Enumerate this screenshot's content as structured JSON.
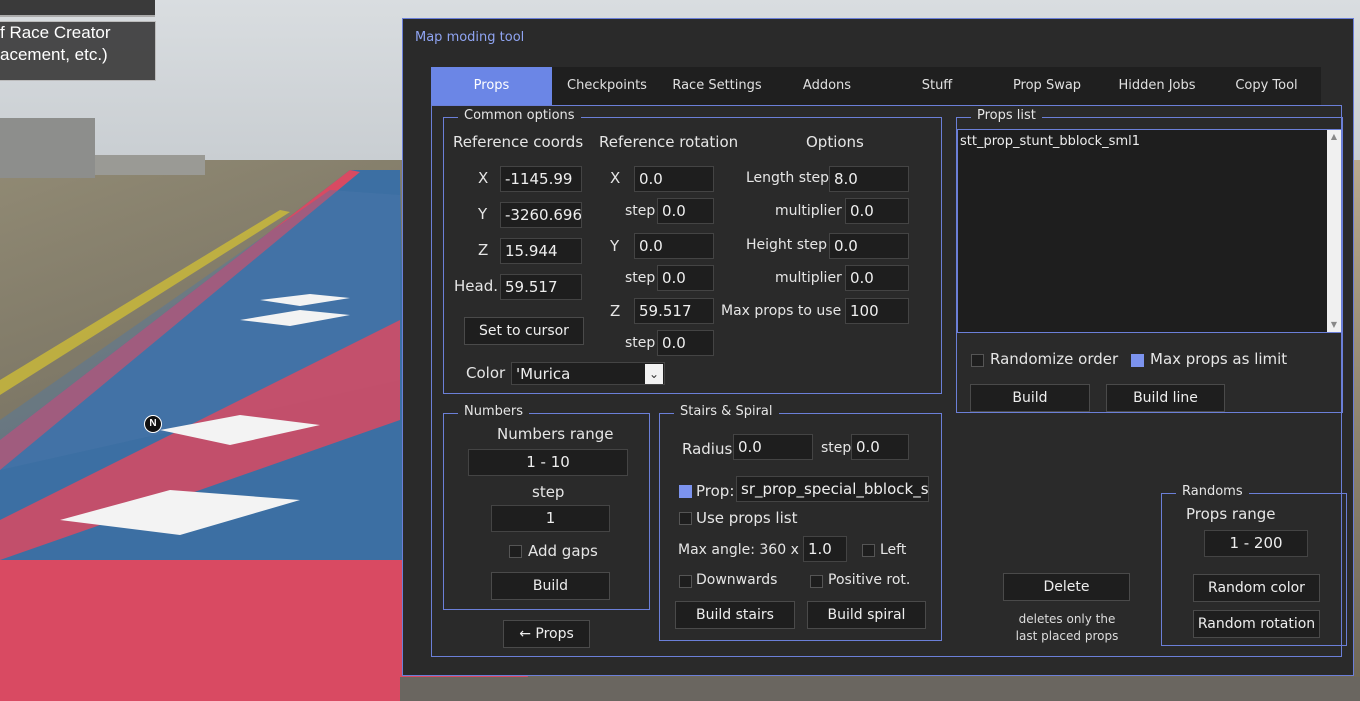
{
  "background": {
    "tooltip_line1": "f Race Creator",
    "tooltip_line2": "acement, etc.)",
    "blip": "N"
  },
  "window": {
    "title": "Map moding tool",
    "tabs": [
      "Props",
      "Checkpoints",
      "Race Settings",
      "Addons",
      "Stuff",
      "Prop Swap",
      "Hidden Jobs",
      "Copy Tool"
    ],
    "active_tab": "Props"
  },
  "common_options": {
    "title": "Common options",
    "ref_coords_label": "Reference coords",
    "ref_rotation_label": "Reference rotation",
    "options_label": "Options",
    "x_label": "X",
    "y_label": "Y",
    "z_label": "Z",
    "head_label": "Head.",
    "x": "-1145.99",
    "y": "-3260.696",
    "z": "15.944",
    "head": "59.517",
    "set_to_cursor": "Set to cursor",
    "rot_x": "0.0",
    "rot_x_step": "0.0",
    "rot_y": "0.0",
    "rot_y_step": "0.0",
    "rot_z": "59.517",
    "rot_z_step": "0.0",
    "step_label": "step",
    "length_step_label": "Length step",
    "length_step": "8.0",
    "multiplier_label": "multiplier",
    "length_multiplier": "0.0",
    "height_step_label": "Height step",
    "height_step": "0.0",
    "height_multiplier": "0.0",
    "max_props_label": "Max props to use",
    "max_props": "100",
    "color_label": "Color",
    "color_value": "'Murica"
  },
  "props_list": {
    "title": "Props list",
    "items": [
      "stt_prop_stunt_bblock_sml1"
    ],
    "randomize_order": "Randomize order",
    "max_props_limit": "Max props as limit",
    "build": "Build",
    "build_line": "Build line"
  },
  "numbers": {
    "title": "Numbers",
    "range_label": "Numbers range",
    "range_value": "1  -  10",
    "step_label": "step",
    "step_value": "1",
    "add_gaps": "Add gaps",
    "build": "Build"
  },
  "back_props": "← Props",
  "stairs": {
    "title": "Stairs & Spiral",
    "radius_label": "Radius",
    "radius": "0.0",
    "step_label": "step",
    "step": "0.0",
    "prop_label": "Prop:",
    "prop_value": "sr_prop_special_bblock_sr",
    "use_props_list": "Use props list",
    "max_angle_label": "Max angle: 360 x",
    "max_angle": "1.0",
    "left": "Left",
    "downwards": "Downwards",
    "positive_rot": "Positive rot.",
    "build_stairs": "Build stairs",
    "build_spiral": "Build spiral"
  },
  "delete": {
    "button": "Delete",
    "note_line1": "deletes only the",
    "note_line2": "last placed props"
  },
  "randoms": {
    "title": "Randoms",
    "range_label": "Props range",
    "range_value": "1  -  200",
    "random_color": "Random color",
    "random_rotation": "Random rotation"
  }
}
